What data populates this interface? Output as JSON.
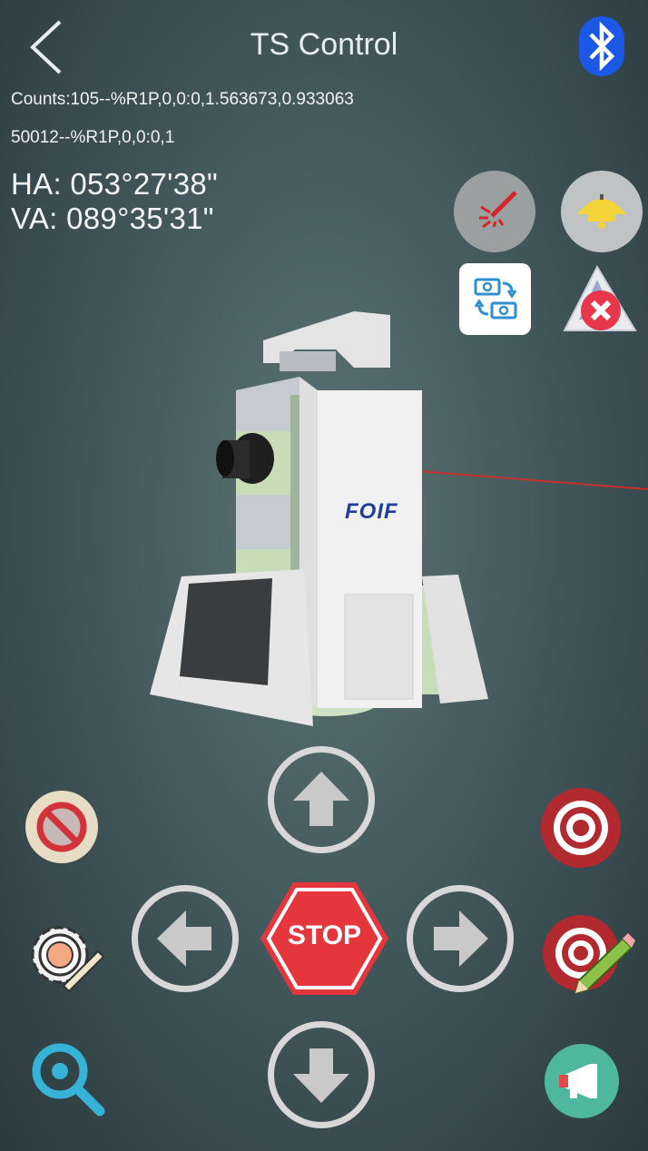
{
  "header": {
    "title": "TS Control",
    "back_icon": "chevron-left-icon",
    "bluetooth_icon": "bluetooth-icon"
  },
  "status": {
    "line1": "Counts:105--%R1P,0,0:0,1.563673,0.933063",
    "line2": "50012--%R1P,0,0:0,1",
    "ha": "HA: 053°27'38\"",
    "va": "VA: 089°35'31\""
  },
  "instrument": {
    "brand": "FOIF",
    "model_icon": "total-station-3d-model"
  },
  "controls": {
    "stop_label": "STOP",
    "laser_icon": "laser-pointer-icon",
    "light_icon": "lamp-icon",
    "swap_icon": "swap-face-icon",
    "prism_clear_icon": "prism-cancel-icon",
    "no_entry_icon": "no-entry-icon",
    "settings_icon": "gear-ruler-icon",
    "search_icon": "zoom-target-icon",
    "target_icon": "target-icon",
    "target_edit_icon": "target-edit-icon",
    "announce_icon": "megaphone-icon"
  },
  "colors": {
    "bluetooth": "#1c58e6",
    "stop": "#e5363d",
    "target": "#b22a2f",
    "laser": "#c8302c"
  }
}
